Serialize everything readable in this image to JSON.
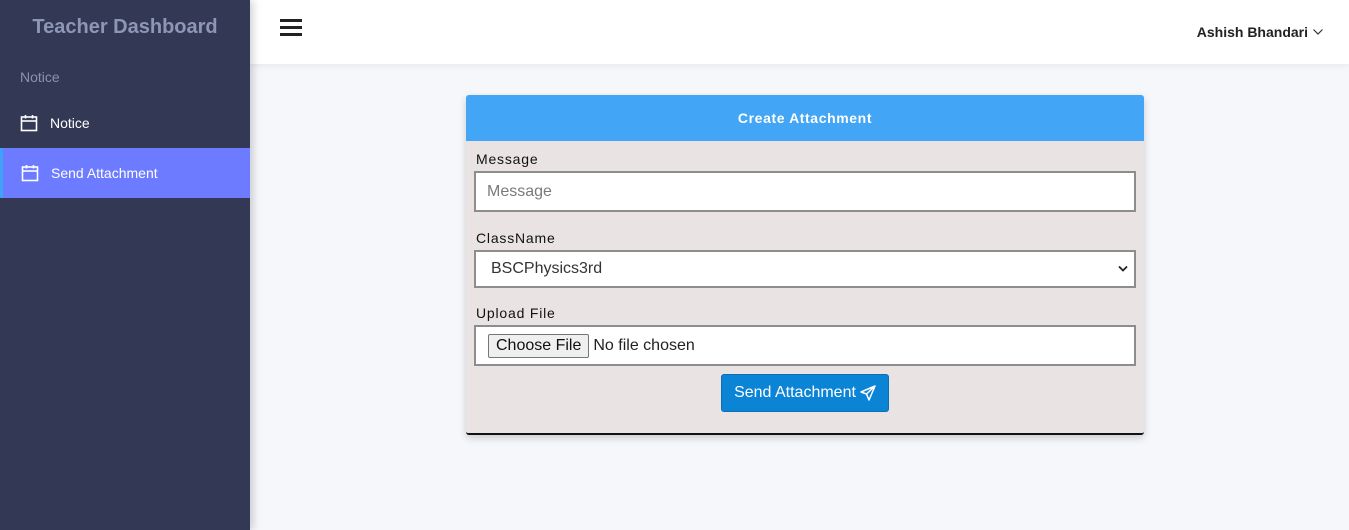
{
  "sidebar": {
    "brand": "Teacher Dashboard",
    "section_label": "Notice",
    "items": [
      {
        "label": "Notice",
        "icon": "calendar-icon",
        "active": false
      },
      {
        "label": "Send Attachment",
        "icon": "calendar-icon",
        "active": true
      }
    ]
  },
  "header": {
    "menu_icon": "hamburger-icon",
    "user_name": "Ashish Bhandari",
    "user_menu_icon": "chevron-down-icon"
  },
  "form": {
    "title": "Create Attachment",
    "message_label": "Message",
    "message_placeholder": "Message",
    "message_value": "",
    "class_label": "ClassName",
    "class_selected": "BSCPhysics3rd",
    "file_label": "Upload File",
    "choose_file_label": "Choose File",
    "file_status": "No file chosen",
    "submit_label": "Send Attachment",
    "submit_icon": "paper-plane-icon"
  },
  "colors": {
    "sidebar_bg": "#333855",
    "active_item_bg": "#6c7bff",
    "card_header_bg": "#42a5f5",
    "card_body_bg": "#e9e3e3",
    "submit_bg": "#0b84d6"
  }
}
